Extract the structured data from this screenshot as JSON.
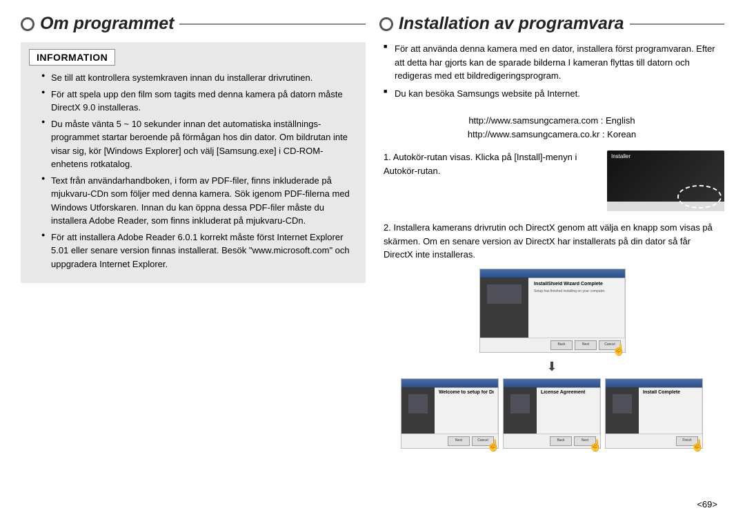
{
  "left": {
    "title": "Om programmet",
    "info_heading": "INFORMATION",
    "bullets": [
      "Se till att kontrollera systemkraven innan du installerar drivrutinen.",
      "För att spela upp den film som tagits med denna kamera på datorn måste DirectX 9.0 installeras.",
      "Du måste vänta 5 ~ 10 sekunder innan det automatiska inställnings-programmet startar beroende på förmågan hos din dator. Om bildrutan inte visar sig, kör [Windows Explorer] och välj [Samsung.exe] i CD-ROM-enhetens rotkatalog.",
      "Text från användarhandboken, i form av PDF-filer, finns inkluderade på mjukvaru-CDn som följer med denna kamera. Sök igenom PDF-filerna med Windows Utforskaren. Innan du kan öppna dessa PDF-filer måste du installera Adobe Reader, som finns inkluderat på mjukvaru-CDn.",
      "För att installera Adobe Reader 6.0.1 korrekt måste först Internet Explorer 5.01 eller senare version finnas installerat. Besök \"www.microsoft.com\" och uppgradera Internet Explorer."
    ]
  },
  "right": {
    "title": "Installation av programvara",
    "intro": [
      "För att använda denna kamera med en dator, installera först programvaran. Efter att detta har gjorts kan de sparade bilderna I kameran flyttas till datorn och redigeras med ett bildredigeringsprogram.",
      "Du kan besöka Samsungs website på Internet."
    ],
    "urls": {
      "en": "http://www.samsungcamera.com : English",
      "kr": "http://www.samsungcamera.co.kr : Korean"
    },
    "step1": "1. Autokör-rutan visas. Klicka på [Install]-menyn i Autokör-rutan.",
    "installer_title": "Installer",
    "step2": "2. Installera kamerans drivrutin och DirectX genom att välja en knapp som visas på skärmen. Om en senare version av DirectX har installerats på din dator så får DirectX inte installeras.",
    "wizard": {
      "heading_a": "InstallShield Wizard Complete",
      "body_a": "Setup has finished installing on your computer.",
      "heading_b": "Welcome to setup for DirectX",
      "heading_c": "License Agreement",
      "heading_d": "Install Complete"
    },
    "btn_back": "Back",
    "btn_next": "Next",
    "btn_cancel": "Cancel",
    "btn_finish": "Finish"
  },
  "page_number": "<69>"
}
